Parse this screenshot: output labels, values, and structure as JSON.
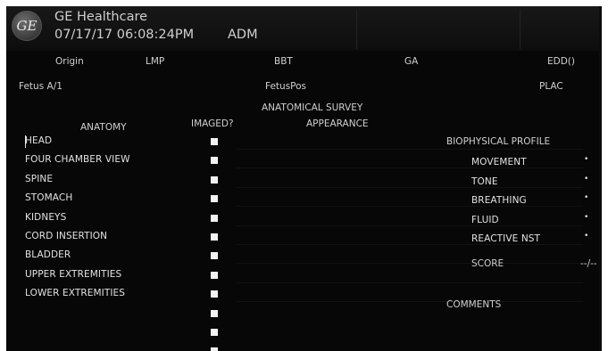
{
  "header": {
    "brand": "GE Healthcare",
    "datetime": "07/17/17 06:08:24PM",
    "user": "ADM",
    "logo_text": "GE",
    "logo_icon": "ge-logo"
  },
  "patient_fields": {
    "origin": "Origin",
    "lmp": "LMP",
    "bbt": "BBT",
    "ga": "GA",
    "edd": "EDD()"
  },
  "fetus": {
    "label": "Fetus A/1",
    "pos": "FetusPos",
    "plac": "PLAC"
  },
  "survey": {
    "title": "ANATOMICAL SURVEY",
    "col_anatomy": "ANATOMY",
    "col_imaged": "IMAGED?",
    "col_appearance": "APPEARANCE",
    "items": [
      {
        "label": "HEAD",
        "imaged": true
      },
      {
        "label": "FOUR CHAMBER VIEW",
        "imaged": true
      },
      {
        "label": "SPINE",
        "imaged": true
      },
      {
        "label": "STOMACH",
        "imaged": true
      },
      {
        "label": "KIDNEYS",
        "imaged": true
      },
      {
        "label": "CORD INSERTION",
        "imaged": true
      },
      {
        "label": "BLADDER",
        "imaged": true
      },
      {
        "label": "UPPER EXTREMITIES",
        "imaged": true
      },
      {
        "label": "LOWER EXTREMITIES",
        "imaged": true
      }
    ],
    "extra_checkbox_count": 3
  },
  "biophysical": {
    "title": "BIOPHYSICAL PROFILE",
    "items": [
      {
        "label": "MOVEMENT",
        "value": "•"
      },
      {
        "label": "TONE",
        "value": "•"
      },
      {
        "label": "BREATHING",
        "value": "•"
      },
      {
        "label": "FLUID",
        "value": "•"
      },
      {
        "label": "REACTIVE NST",
        "value": "•"
      }
    ],
    "score_label": "SCORE",
    "score_value": "--/--",
    "comments_label": "COMMENTS"
  },
  "colors": {
    "background": "#070707",
    "text": "#e2e2e2",
    "checkbox": "#f2f2f2"
  }
}
